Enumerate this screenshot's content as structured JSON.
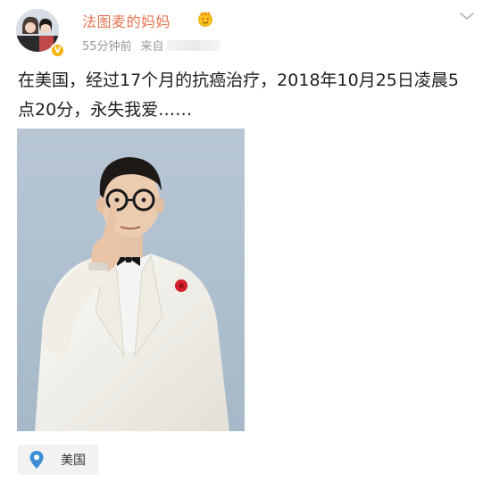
{
  "post": {
    "author": {
      "name": "法图麦的妈妈",
      "verified": true,
      "avatar_icon": "avatar-photo-icon",
      "emoji_icon": "crown-heart-eyes-emoji-icon"
    },
    "time": "55分钟前",
    "source_prefix": "来自",
    "text": "在美国，经过17个月的抗癌治疗，2018年10月25日凌晨5点20分，永失我爱……",
    "image_icon": "portrait-photo-man-white-tuxedo-icon",
    "location": "美国",
    "colors": {
      "username": "#eb7350",
      "verified_badge": "#f6b20d",
      "meta": "#9a9a9a",
      "location_pin": "#3d8ed6"
    }
  }
}
